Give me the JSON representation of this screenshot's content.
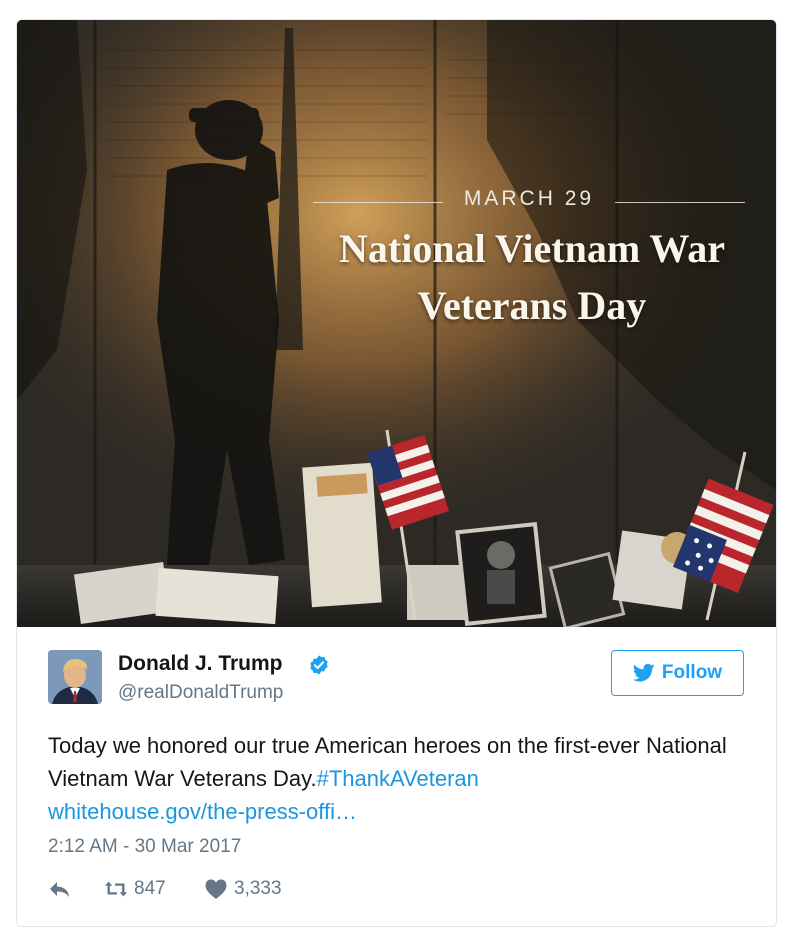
{
  "media": {
    "date": "MARCH 29",
    "title_line1": "National Vietnam War",
    "title_line2": "Veterans Day"
  },
  "author": {
    "name": "Donald J. Trump",
    "handle": "@realDonaldTrump",
    "verified": true
  },
  "follow_label": "Follow",
  "tweet": {
    "text_before": "Today we honored our true American heroes on the first-ever National Vietnam War Veterans Day.",
    "hashtag": "#ThankAVeteran",
    "link": "whitehouse.gov/the-press-offi…"
  },
  "timestamp": "2:12 AM - 30 Mar 2017",
  "stats": {
    "retweets": "847",
    "likes": "3,333"
  },
  "icons": {
    "reply": "reply-icon",
    "retweet": "retweet-icon",
    "like": "heart-icon",
    "follow": "twitter-bird-icon",
    "verified": "verified-badge-icon"
  },
  "colors": {
    "accent": "#1da1f2",
    "link": "#1b95e0",
    "muted": "#657786"
  }
}
